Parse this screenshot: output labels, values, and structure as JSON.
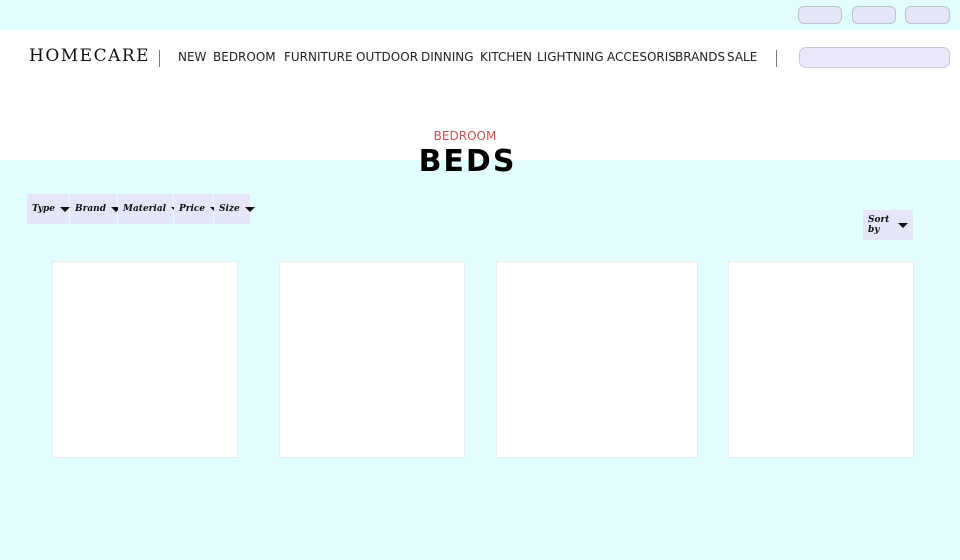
{
  "header": {
    "logo": "HOMECARE",
    "nav": [
      "NEW",
      "BEDROOM",
      "FURNITURE",
      "OUTDOOR",
      "DINNING",
      "KITCHEN",
      "LIGHTNING",
      "ACCESORIS",
      "BRANDS",
      "SALE"
    ],
    "search": {
      "value": "",
      "placeholder": ""
    }
  },
  "page": {
    "breadcrumb": "BEDROOM",
    "title": "BEDS"
  },
  "filters": [
    "Type",
    "Brand",
    "Material",
    "Price",
    "Size"
  ],
  "sort_label": "Sort by",
  "colors": {
    "background": "#e3fefe",
    "header": "#ffffff",
    "control": "#e6e6fa",
    "breadcrumb": "#c8524f"
  }
}
